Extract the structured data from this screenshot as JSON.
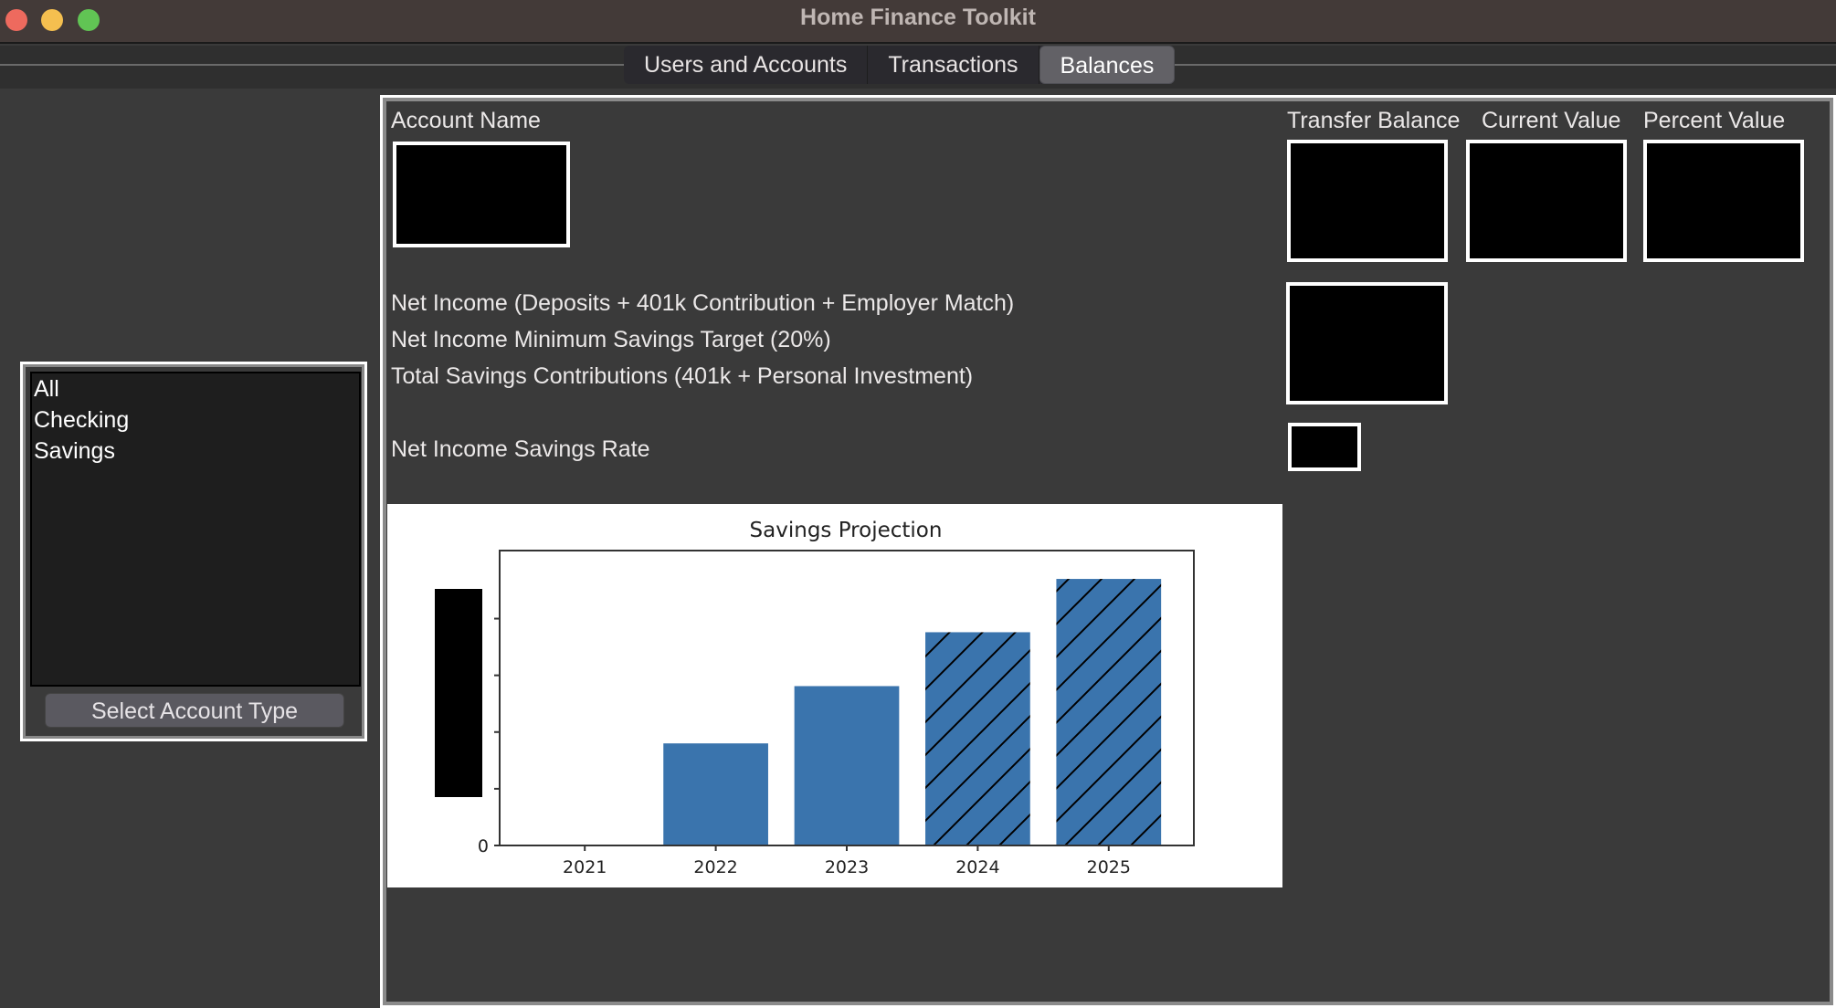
{
  "window": {
    "title": "Home Finance Toolkit",
    "controls": [
      "close",
      "minimize",
      "maximize"
    ]
  },
  "tabs": [
    {
      "label": "Users and Accounts",
      "active": false
    },
    {
      "label": "Transactions",
      "active": false
    },
    {
      "label": "Balances",
      "active": true
    }
  ],
  "account_type_panel": {
    "items": [
      "All",
      "Checking",
      "Savings"
    ],
    "button_label": "Select Account Type"
  },
  "balances": {
    "headers": {
      "account_name": "Account Name",
      "transfer_balance": "Transfer Balance",
      "current_value": "Current Value",
      "percent_value": "Percent Value"
    },
    "summary_labels": {
      "net_income": "Net Income (Deposits + 401k Contribution + Employer Match)",
      "min_savings_target": "Net Income Minimum Savings Target (20%)",
      "total_savings": "Total Savings Contributions (401k + Personal Investment)",
      "savings_rate": "Net Income Savings Rate"
    },
    "redacted_value_blocks": [
      "account-names",
      "transfer-balances",
      "current-values",
      "percent-values",
      "summary-values",
      "savings-rate-value"
    ]
  },
  "colors": {
    "bar": "#3a74ad",
    "hatch": "#000000",
    "panel_bg": "#3a3a3a",
    "titlebar_bg": "#433a38"
  },
  "chart_data": {
    "type": "bar",
    "title": "Savings Projection",
    "xlabel": "",
    "ylabel": "",
    "categories": [
      "2021",
      "2022",
      "2023",
      "2024",
      "2025"
    ],
    "values": [
      0,
      1.8,
      2.81,
      3.76,
      4.7
    ],
    "value_units": "y-axis tick intervals (tick labels redacted)",
    "projected": [
      false,
      false,
      false,
      true,
      true
    ],
    "hatch_projected": "/",
    "y_tick_labels_visible": [
      "0"
    ],
    "y_ticks_count": 5,
    "ylim": [
      0,
      5.2
    ],
    "grid": false,
    "legend": "none",
    "y_tick_labels_redacted": true
  }
}
